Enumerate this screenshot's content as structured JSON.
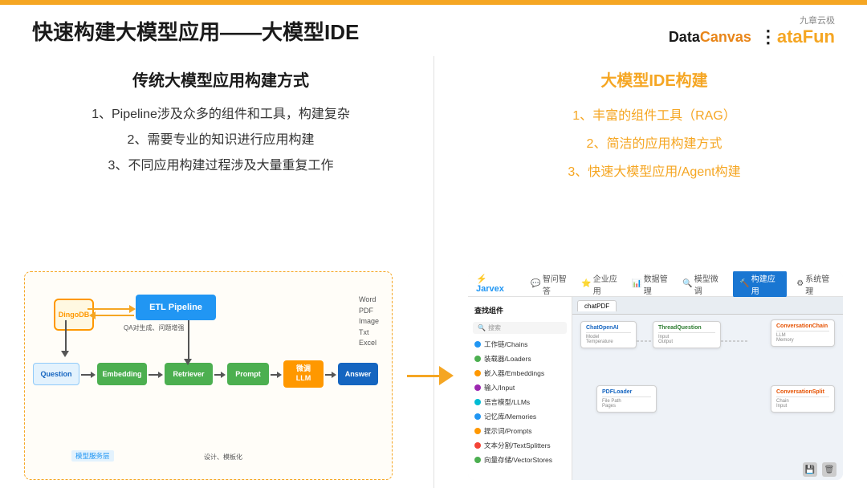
{
  "topbar": {
    "color": "#f5a623"
  },
  "header": {
    "title": "快速构建大模型应用——大模型IDE",
    "logo_nine": "九章云极",
    "logo_datacanvas": "DataCanvas",
    "logo_datafun": "DataFun"
  },
  "left": {
    "section_title": "传统大模型应用构建方式",
    "items": [
      "1、Pipeline涉及众多的组件和工具，构建复杂",
      "2、需要专业的知识进行应用构建",
      "3、不同应用构建过程涉及大量重复工作"
    ]
  },
  "right": {
    "section_title": "大模型IDE构建",
    "items": [
      "1、丰富的组件工具（RAG）",
      "2、简洁的应用构建方式",
      "3、快速大模型应用/Agent构建"
    ]
  },
  "pipeline": {
    "qa_label": "QA对生成、问题增强",
    "design_label": "设计、模板化",
    "model_service": "模型服务层",
    "etl": "ETL Pipeline",
    "embedding": "Embedding",
    "retriever": "Retriever",
    "prompt": "Prompt",
    "finetune": "微调\nLLM",
    "answer": "Answer",
    "question": "Question",
    "dingobd": "DingoDB",
    "file_types": "Word\nPDF\nImage\nTxt\nExcel"
  },
  "ide": {
    "logo": "Jarvex",
    "nav_items": [
      "智问智答",
      "企业应用",
      "数据管理",
      "模型微调",
      "构建应用",
      "系统管理"
    ],
    "active_nav": "构建应用",
    "sidebar_title": "查找组件",
    "search_placeholder": "搜索",
    "menu_items": [
      "工作链/Chains",
      "装载器/Loaders",
      "嵌入器/Embeddings",
      "输入/Input",
      "语言模型/LLMs",
      "记忆库/Memories",
      "提示词/Prompts",
      "文本分割/TextSplitters",
      "向量存储/VectorStores"
    ],
    "canvas_title": "chatPDF",
    "nodes": [
      {
        "label": "ChatOpenAI",
        "type": "blue"
      },
      {
        "label": "ThreadQuestion",
        "type": "green"
      },
      {
        "label": "ConversationChain",
        "type": "orange"
      },
      {
        "label": "PDFLoader",
        "type": "blue"
      }
    ]
  }
}
